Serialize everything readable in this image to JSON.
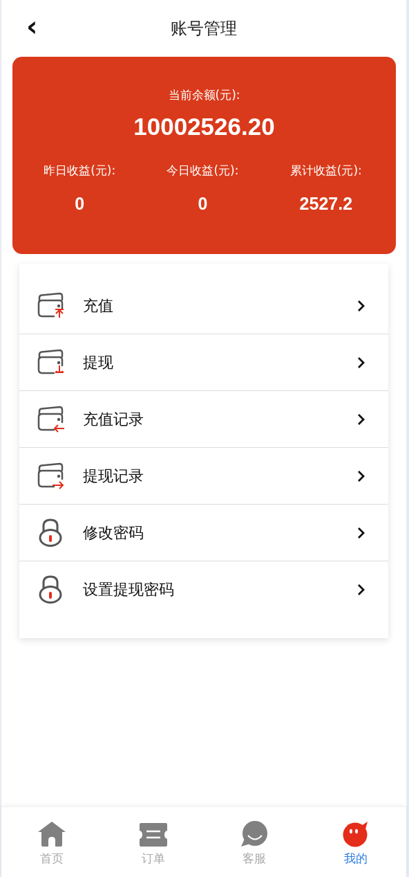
{
  "header": {
    "back": "‹",
    "title": "账号管理"
  },
  "balance": {
    "label": "当前余额(元):",
    "value": "10002526.20",
    "stats": [
      {
        "label": "昨日收益(元):",
        "value": "0"
      },
      {
        "label": "今日收益(元):",
        "value": "0"
      },
      {
        "label": "累计收益(元):",
        "value": "2527.2"
      }
    ]
  },
  "menu": [
    {
      "kind": "wallet-up",
      "label": "充值"
    },
    {
      "kind": "wallet-down",
      "label": "提现"
    },
    {
      "kind": "wallet-left",
      "label": "充值记录"
    },
    {
      "kind": "wallet-right",
      "label": "提现记录"
    },
    {
      "kind": "lock",
      "label": "修改密码"
    },
    {
      "kind": "lock",
      "label": "设置提现密码"
    }
  ],
  "tabs": [
    {
      "kind": "home",
      "label": "首页",
      "selected": false
    },
    {
      "kind": "ticket",
      "label": "订单",
      "selected": false
    },
    {
      "kind": "chat",
      "label": "客服",
      "selected": false
    },
    {
      "kind": "face",
      "label": "我的",
      "selected": true
    }
  ]
}
